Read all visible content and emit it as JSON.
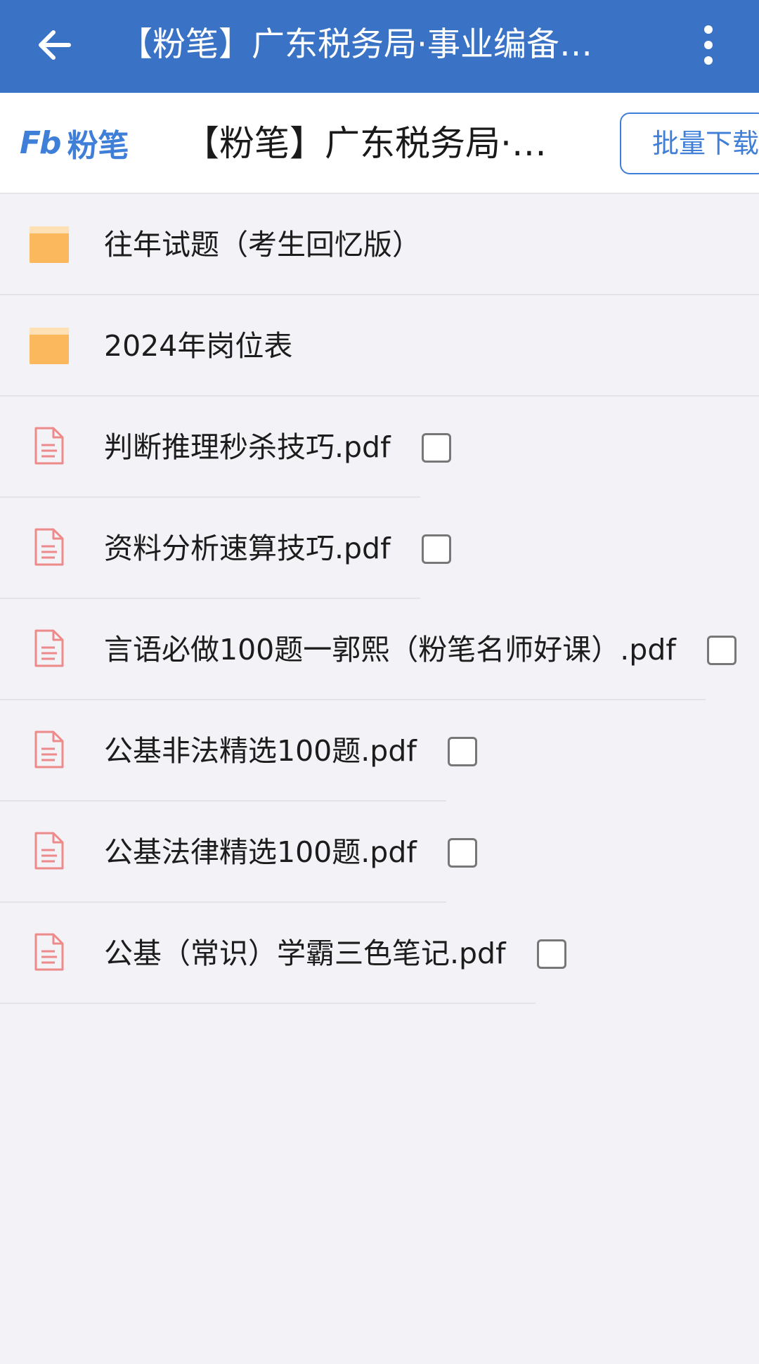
{
  "appbar": {
    "title": "【粉笔】广东税务局·事业编备…",
    "back_icon": "arrow-left-icon",
    "menu_icon": "more-vertical-icon"
  },
  "header": {
    "logo_mark": "Fb",
    "logo_name": "粉笔",
    "title": "【粉笔】广东税务局·事…",
    "batch_download": "批量下载"
  },
  "colors": {
    "appbar": "#3a73c6",
    "accent": "#3f7fd8",
    "folder": "#fcb85c",
    "file_icon": "#ef8a8a"
  },
  "items": [
    {
      "type": "folder",
      "name": "往年试题（考生回忆版）"
    },
    {
      "type": "folder",
      "name": "2024年岗位表"
    },
    {
      "type": "file",
      "name": "判断推理秒杀技巧.pdf",
      "checked": false
    },
    {
      "type": "file",
      "name": "资料分析速算技巧.pdf",
      "checked": false
    },
    {
      "type": "file",
      "name": "言语必做100题一郭熙（粉笔名师好课）.pdf",
      "checked": false
    },
    {
      "type": "file",
      "name": "公基非法精选100题.pdf",
      "checked": false
    },
    {
      "type": "file",
      "name": "公基法律精选100题.pdf",
      "checked": false
    },
    {
      "type": "file",
      "name": "公基（常识）学霸三色笔记.pdf",
      "checked": false
    }
  ]
}
